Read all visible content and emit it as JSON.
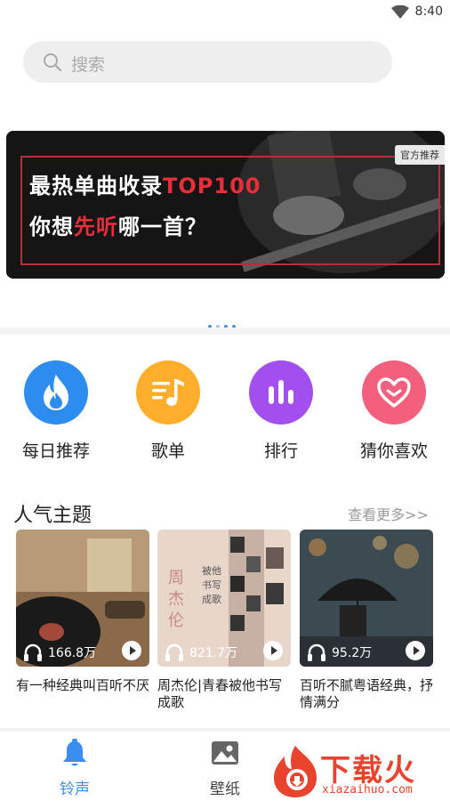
{
  "status": {
    "time": "8:40"
  },
  "search": {
    "placeholder": "搜索"
  },
  "banner": {
    "line1_a": "最热单曲收录",
    "line1_b": "TOP100",
    "line2_a": "你想",
    "line2_b": "先听",
    "line2_c": "哪一首？",
    "badge": "官方推荐"
  },
  "categories": [
    {
      "label": "每日推荐",
      "icon": "flame-icon",
      "color": "#2d8cf0"
    },
    {
      "label": "歌单",
      "icon": "playlist-icon",
      "color": "#ffae2b"
    },
    {
      "label": "排行",
      "icon": "chart-bars-icon",
      "color": "#a34ff0"
    },
    {
      "label": "猜你喜欢",
      "icon": "heart-icon",
      "color": "#f2607d"
    }
  ],
  "popular": {
    "title": "人气主题",
    "more": "查看更多>>",
    "items": [
      {
        "count": "166.8万",
        "title": "有一种经典叫百听不厌"
      },
      {
        "count": "821.7万",
        "title": "周杰伦|青春被他书写成歌"
      },
      {
        "count": "95.2万",
        "title": "百听不腻粤语经典，抒情满分"
      }
    ]
  },
  "tabs": [
    {
      "label": "铃声",
      "icon": "bell-icon",
      "active": true
    },
    {
      "label": "壁纸",
      "icon": "picture-icon",
      "active": false
    }
  ],
  "watermark": {
    "text": "下载火",
    "url": "xiazaihuo.com"
  }
}
